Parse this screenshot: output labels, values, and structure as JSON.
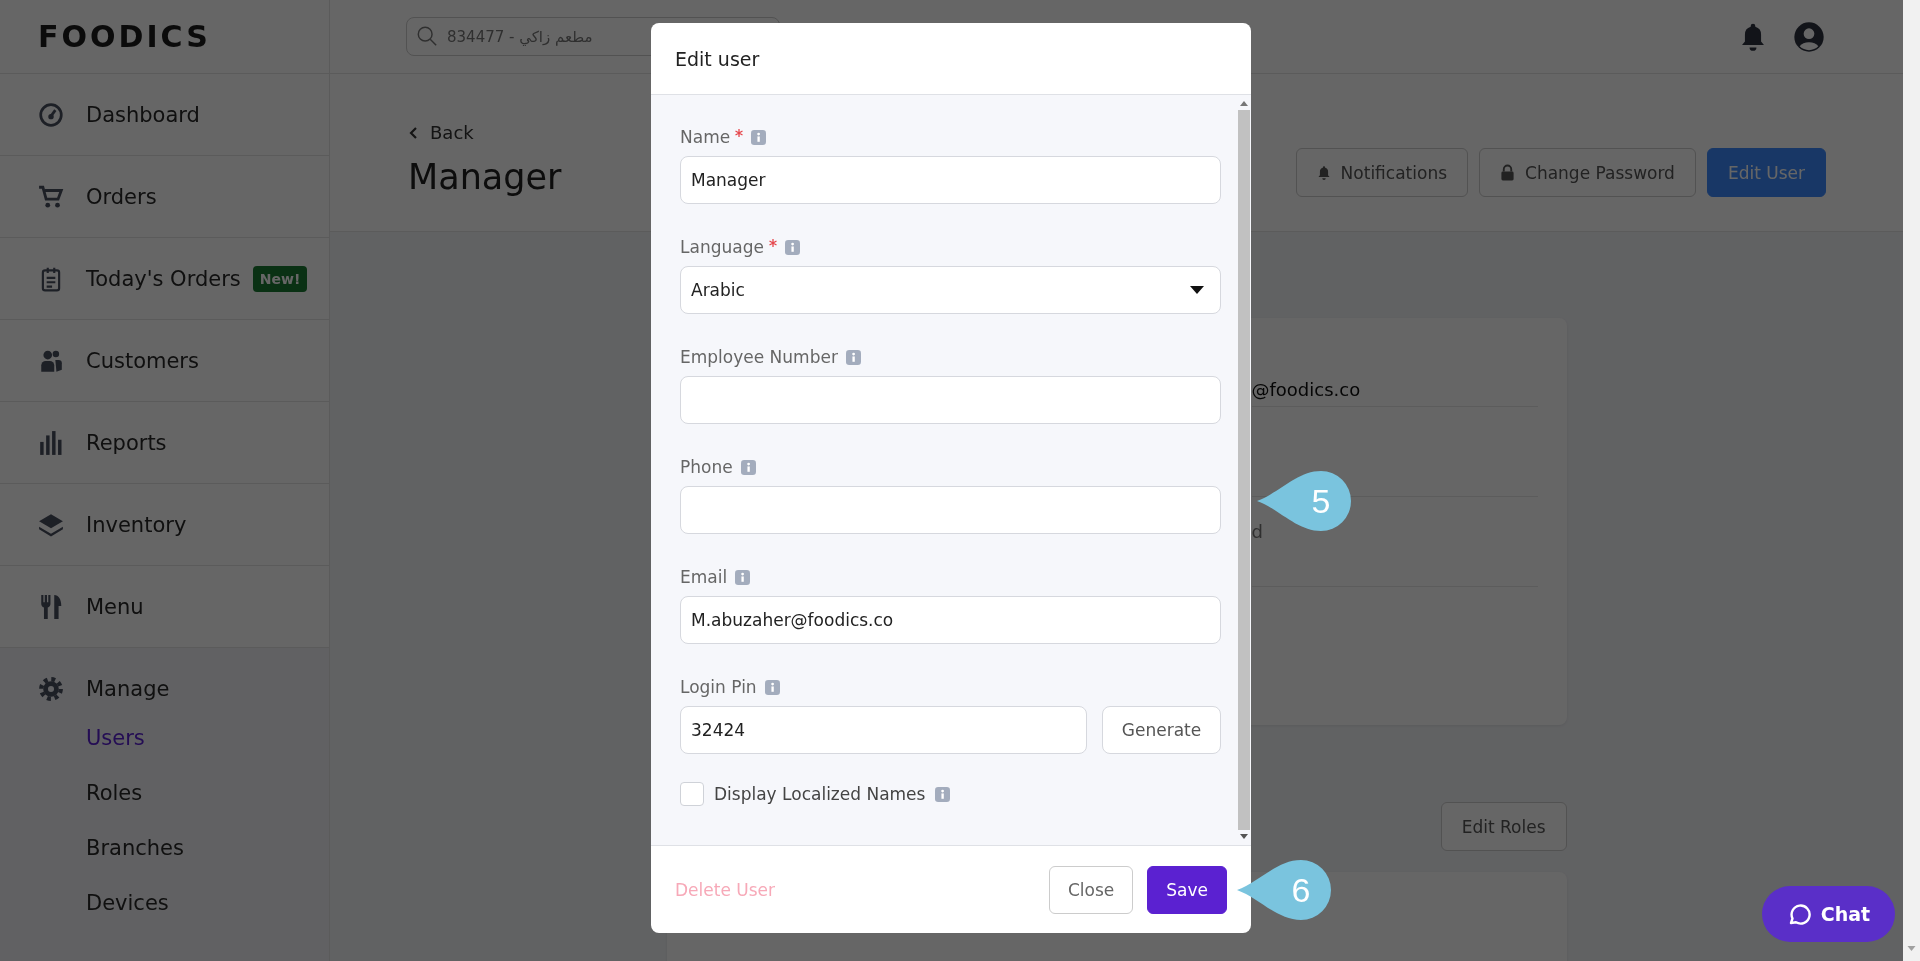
{
  "header": {
    "logo": "FOODICS",
    "search": {
      "placeholder": "834477 - مطعم زاكي"
    }
  },
  "sidebar": {
    "items": [
      {
        "label": "Dashboard"
      },
      {
        "label": "Orders"
      },
      {
        "label": "Today's Orders",
        "badge": "New!"
      },
      {
        "label": "Customers"
      },
      {
        "label": "Reports"
      },
      {
        "label": "Inventory"
      },
      {
        "label": "Menu"
      },
      {
        "label": "Manage",
        "expanded": true,
        "children": [
          {
            "label": "Users",
            "selected": true
          },
          {
            "label": "Roles",
            "selected": false
          },
          {
            "label": "Branches",
            "selected": false
          },
          {
            "label": "Devices",
            "selected": false
          }
        ]
      }
    ]
  },
  "page": {
    "back": "Back",
    "title": "Manager",
    "actions": [
      {
        "label": "Notifications",
        "kind": "bell"
      },
      {
        "label": "Change Password",
        "kind": "lock"
      },
      {
        "label": "Edit User",
        "kind": "primary"
      }
    ],
    "card_rows": [
      {
        "text": "@foodics.co",
        "kind": "value"
      },
      {
        "kind": "empty"
      },
      {
        "text": "d",
        "kind": "label"
      }
    ],
    "edit_roles": "Edit Roles"
  },
  "modal": {
    "title": "Edit user",
    "fields": [
      {
        "label": "Name",
        "required": true,
        "kind": "text",
        "value": "Manager"
      },
      {
        "label": "Language",
        "required": true,
        "kind": "select",
        "value": "Arabic"
      },
      {
        "label": "Employee Number",
        "required": false,
        "kind": "text"
      },
      {
        "label": "Phone",
        "required": false,
        "kind": "text"
      },
      {
        "label": "Email",
        "required": false,
        "kind": "text",
        "value": "M.abuzaher@foodics.co"
      },
      {
        "label": "Login Pin",
        "required": false,
        "kind": "pin",
        "value": "32424",
        "button": "Generate"
      }
    ],
    "checkbox": {
      "label": "Display Localized Names",
      "checked": false
    },
    "delete": "Delete User",
    "buttons": [
      {
        "label": "Close",
        "kind": "secondary"
      },
      {
        "label": "Save",
        "kind": "primary"
      }
    ]
  },
  "chat": "Chat",
  "callouts": [
    "5",
    "6"
  ]
}
